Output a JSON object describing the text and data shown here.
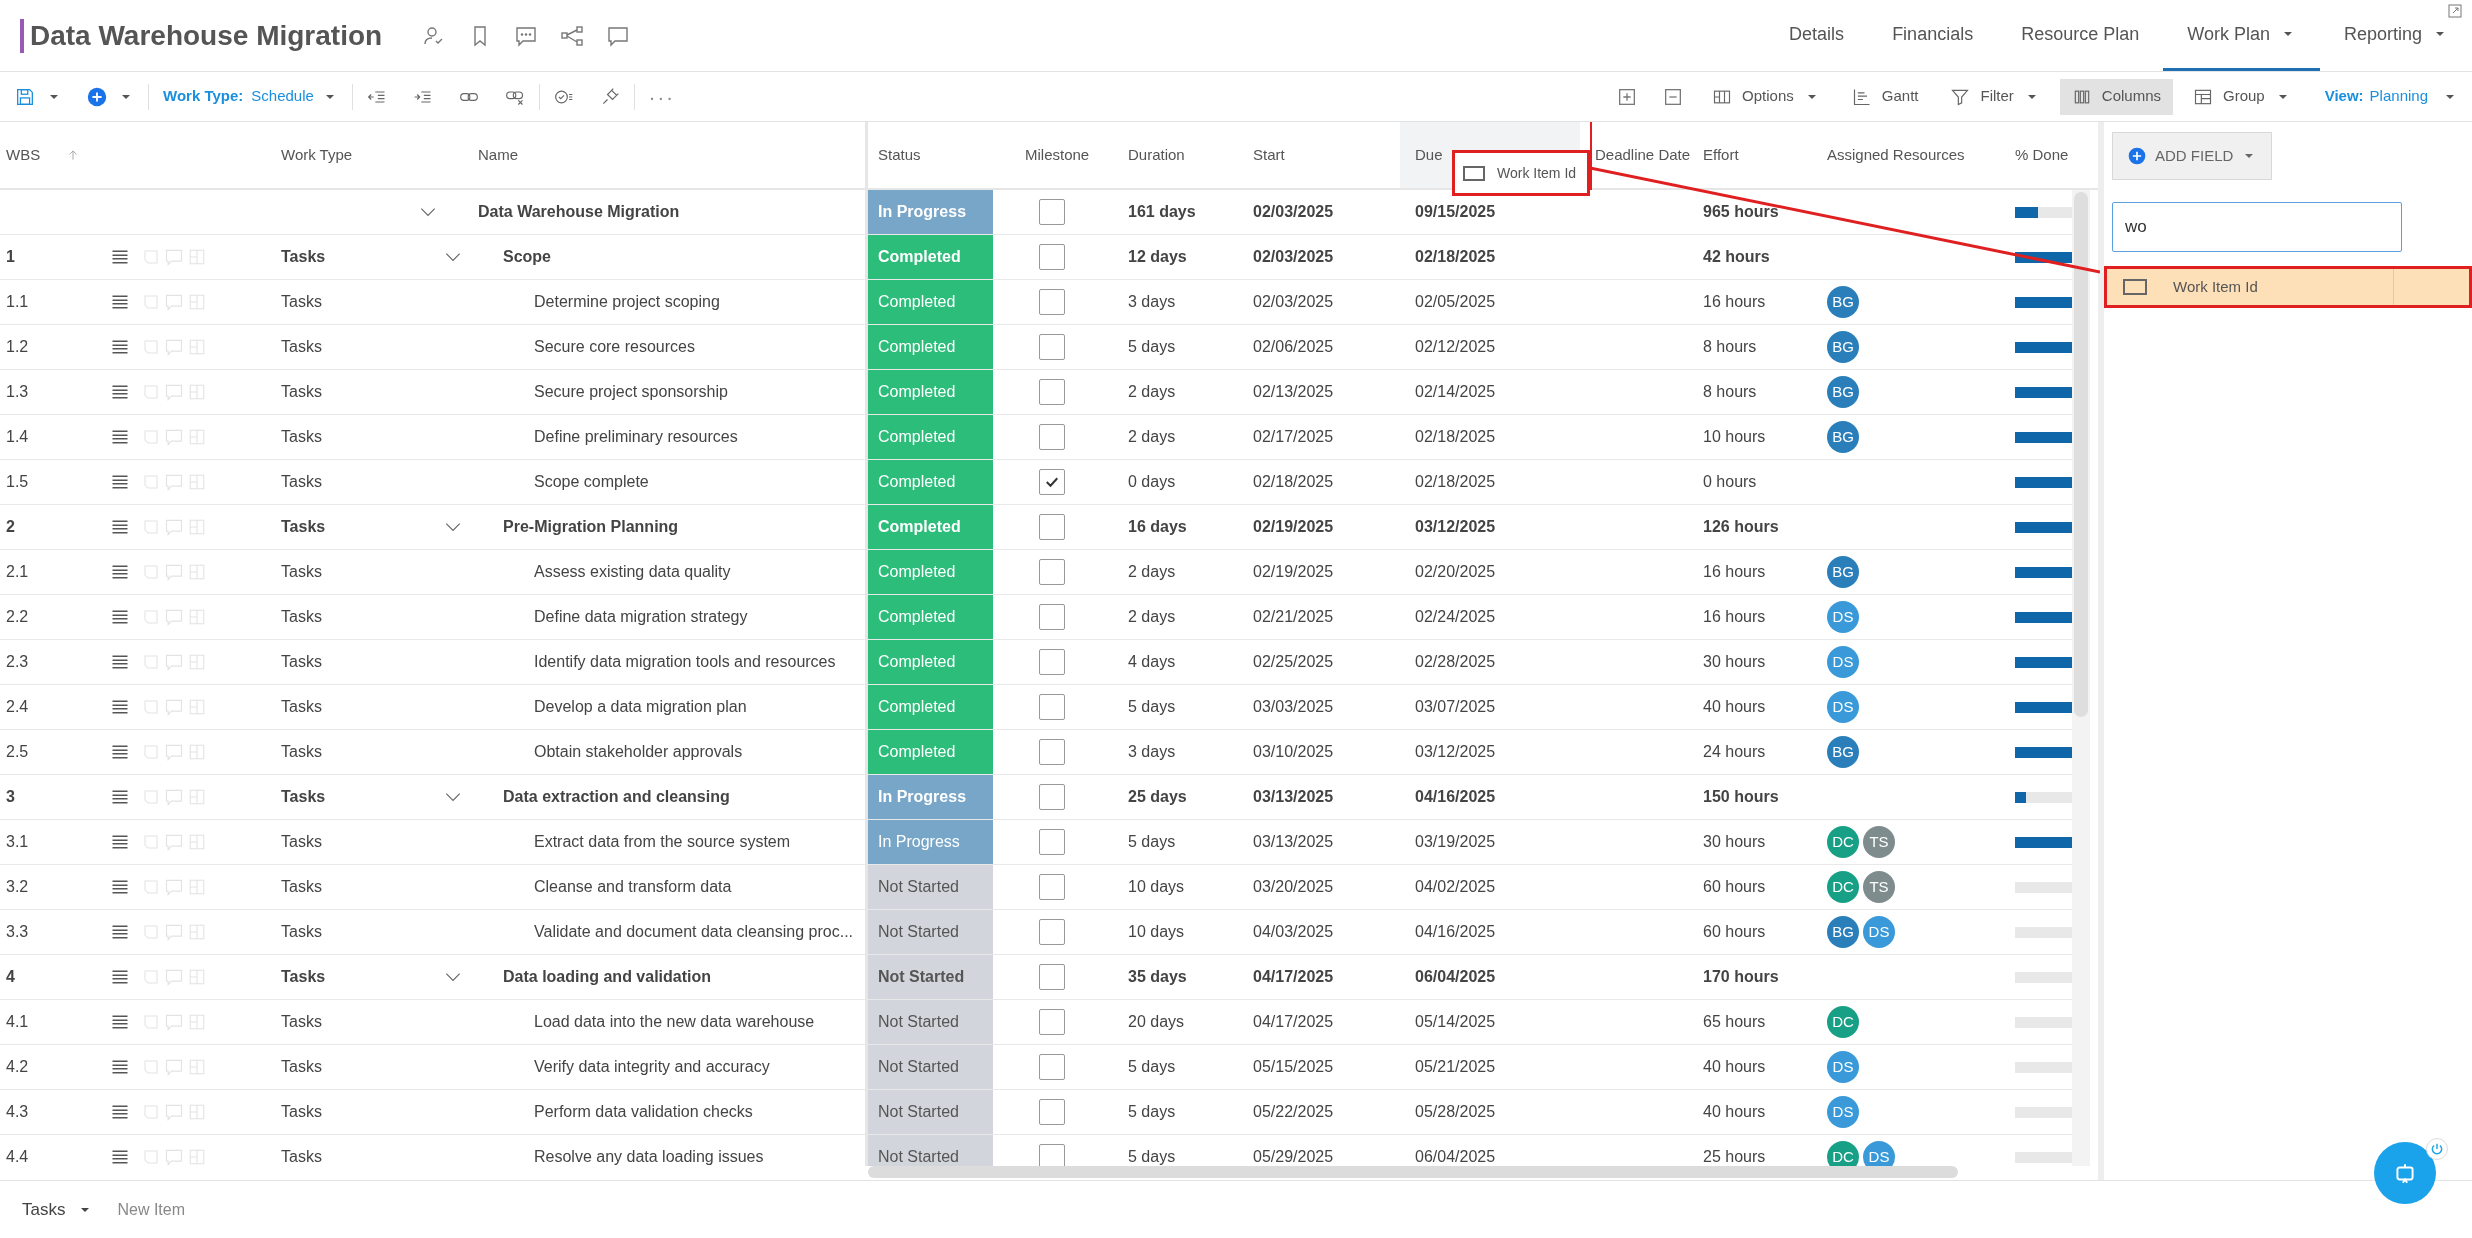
{
  "project": {
    "title": "Data Warehouse Migration"
  },
  "nav_tabs": [
    {
      "label": "Details",
      "selected": false,
      "dropdown": false
    },
    {
      "label": "Financials",
      "selected": false,
      "dropdown": false
    },
    {
      "label": "Resource Plan",
      "selected": false,
      "dropdown": false
    },
    {
      "label": "Work Plan",
      "selected": true,
      "dropdown": true
    },
    {
      "label": "Reporting",
      "selected": false,
      "dropdown": true
    }
  ],
  "toolbar": {
    "work_type": {
      "label": "Work Type:",
      "value": "Schedule"
    },
    "more": "···",
    "buttons": [
      {
        "kind": "options",
        "label": "Options",
        "dropdown": true,
        "selected": false
      },
      {
        "kind": "gantt",
        "label": "Gantt",
        "dropdown": false,
        "selected": false
      },
      {
        "kind": "filter",
        "label": "Filter",
        "dropdown": true,
        "selected": false
      },
      {
        "kind": "columns",
        "label": "Columns",
        "dropdown": false,
        "selected": true
      },
      {
        "kind": "group",
        "label": "Group",
        "dropdown": true,
        "selected": false
      }
    ],
    "view": {
      "label": "View:",
      "value": "Planning"
    }
  },
  "columns": [
    {
      "label": "WBS",
      "sorted_ascending": true,
      "drop_target": false
    },
    {
      "label": "Work Type",
      "sorted_ascending": false,
      "drop_target": false
    },
    {
      "label": "Name",
      "sorted_ascending": false,
      "drop_target": false
    },
    {
      "label": "Status",
      "sorted_ascending": false,
      "drop_target": false
    },
    {
      "label": "Milestone",
      "sorted_ascending": false,
      "drop_target": false
    },
    {
      "label": "Duration",
      "sorted_ascending": false,
      "drop_target": false
    },
    {
      "label": "Start",
      "sorted_ascending": false,
      "drop_target": false
    },
    {
      "label": "Due",
      "sorted_ascending": false,
      "drop_target": true
    },
    {
      "label": "Deadline Date",
      "sorted_ascending": false,
      "drop_target": false
    },
    {
      "label": "Effort",
      "sorted_ascending": false,
      "drop_target": false
    },
    {
      "label": "Assigned Resources",
      "sorted_ascending": false,
      "drop_target": false
    },
    {
      "label": "% Done",
      "sorted_ascending": false,
      "drop_target": false
    }
  ],
  "rows": [
    {
      "name": "Data Warehouse Migration",
      "status": "In Progress",
      "color": "#78a6c8",
      "milestone": false,
      "duration": "161 days",
      "start": "02/03/2025",
      "due": "09/15/2025",
      "effort": "965 hours",
      "level": 0.4,
      "expanded": true,
      "children": [
        {
          "wbs": "1",
          "work_type": "Tasks",
          "name": "Scope",
          "status": "Completed",
          "color": "#2dbd7b",
          "milestone": false,
          "duration": "12 days",
          "start": "02/03/2025",
          "due": "02/18/2025",
          "effort": "42 hours",
          "level": 1,
          "expanded": true,
          "children": [
            {
              "wbs": "1.1",
              "work_type": "Tasks",
              "name": "Determine project scoping",
              "status": "Completed",
              "color": "#2dbd7b",
              "milestone": false,
              "duration": "3 days",
              "start": "02/03/2025",
              "due": "02/05/2025",
              "effort": "16 hours",
              "level": 1,
              "resources": [
                {
                  "initials": "BG",
                  "color": "#2a7fba"
                }
              ]
            },
            {
              "wbs": "1.2",
              "work_type": "Tasks",
              "name": "Secure core resources",
              "status": "Completed",
              "color": "#2dbd7b",
              "milestone": false,
              "duration": "5 days",
              "start": "02/06/2025",
              "due": "02/12/2025",
              "effort": "8 hours",
              "level": 1,
              "resources": [
                {
                  "initials": "BG",
                  "color": "#2a7fba"
                }
              ]
            },
            {
              "wbs": "1.3",
              "work_type": "Tasks",
              "name": "Secure project sponsorship",
              "status": "Completed",
              "color": "#2dbd7b",
              "milestone": false,
              "duration": "2 days",
              "start": "02/13/2025",
              "due": "02/14/2025",
              "effort": "8 hours",
              "level": 1,
              "resources": [
                {
                  "initials": "BG",
                  "color": "#2a7fba"
                }
              ]
            },
            {
              "wbs": "1.4",
              "work_type": "Tasks",
              "name": "Define preliminary resources",
              "status": "Completed",
              "color": "#2dbd7b",
              "milestone": false,
              "duration": "2 days",
              "start": "02/17/2025",
              "due": "02/18/2025",
              "effort": "10 hours",
              "level": 1,
              "resources": [
                {
                  "initials": "BG",
                  "color": "#2a7fba"
                }
              ]
            },
            {
              "wbs": "1.5",
              "work_type": "Tasks",
              "name": "Scope complete",
              "status": "Completed",
              "color": "#2dbd7b",
              "milestone": true,
              "duration": "0 days",
              "start": "02/18/2025",
              "due": "02/18/2025",
              "effort": "0 hours",
              "level": 1
            }
          ]
        },
        {
          "wbs": "2",
          "work_type": "Tasks",
          "name": "Pre-Migration Planning",
          "status": "Completed",
          "color": "#2dbd7b",
          "milestone": false,
          "duration": "16 days",
          "start": "02/19/2025",
          "due": "03/12/2025",
          "effort": "126 hours",
          "level": 1,
          "expanded": true,
          "children": [
            {
              "wbs": "2.1",
              "work_type": "Tasks",
              "name": "Assess existing data quality",
              "status": "Completed",
              "color": "#2dbd7b",
              "milestone": false,
              "duration": "2 days",
              "start": "02/19/2025",
              "due": "02/20/2025",
              "effort": "16 hours",
              "level": 1,
              "resources": [
                {
                  "initials": "BG",
                  "color": "#2a7fba"
                }
              ]
            },
            {
              "wbs": "2.2",
              "work_type": "Tasks",
              "name": "Define data migration strategy",
              "status": "Completed",
              "color": "#2dbd7b",
              "milestone": false,
              "duration": "2 days",
              "start": "02/21/2025",
              "due": "02/24/2025",
              "effort": "16 hours",
              "level": 1,
              "resources": [
                {
                  "initials": "DS",
                  "color": "#3a9ad9"
                }
              ]
            },
            {
              "wbs": "2.3",
              "work_type": "Tasks",
              "name": "Identify data migration tools and resources",
              "status": "Completed",
              "color": "#2dbd7b",
              "milestone": false,
              "duration": "4 days",
              "start": "02/25/2025",
              "due": "02/28/2025",
              "effort": "30 hours",
              "level": 1,
              "resources": [
                {
                  "initials": "DS",
                  "color": "#3a9ad9"
                }
              ]
            },
            {
              "wbs": "2.4",
              "work_type": "Tasks",
              "name": "Develop a data migration plan",
              "status": "Completed",
              "color": "#2dbd7b",
              "milestone": false,
              "duration": "5 days",
              "start": "03/03/2025",
              "due": "03/07/2025",
              "effort": "40 hours",
              "level": 1,
              "resources": [
                {
                  "initials": "DS",
                  "color": "#3a9ad9"
                }
              ]
            },
            {
              "wbs": "2.5",
              "work_type": "Tasks",
              "name": "Obtain stakeholder approvals",
              "status": "Completed",
              "color": "#2dbd7b",
              "milestone": false,
              "duration": "3 days",
              "start": "03/10/2025",
              "due": "03/12/2025",
              "effort": "24 hours",
              "level": 1,
              "resources": [
                {
                  "initials": "BG",
                  "color": "#2a7fba"
                }
              ]
            }
          ]
        },
        {
          "wbs": "3",
          "work_type": "Tasks",
          "name": "Data extraction and cleansing",
          "status": "In Progress",
          "color": "#78a6c8",
          "milestone": false,
          "duration": "25 days",
          "start": "03/13/2025",
          "due": "04/16/2025",
          "effort": "150 hours",
          "level": 0.2,
          "expanded": true,
          "children": [
            {
              "wbs": "3.1",
              "work_type": "Tasks",
              "name": "Extract data from the source system",
              "status": "In Progress",
              "color": "#78a6c8",
              "milestone": false,
              "duration": "5 days",
              "start": "03/13/2025",
              "due": "03/19/2025",
              "effort": "30 hours",
              "level": 1,
              "resources": [
                {
                  "initials": "DC",
                  "color": "#17a085"
                },
                {
                  "initials": "TS",
                  "color": "#7f8c8d"
                }
              ]
            },
            {
              "wbs": "3.2",
              "work_type": "Tasks",
              "name": "Cleanse and transform data",
              "status": "Not Started",
              "color": "#d2d5db",
              "milestone": false,
              "duration": "10 days",
              "start": "03/20/2025",
              "due": "04/02/2025",
              "effort": "60 hours",
              "level": 0,
              "resources": [
                {
                  "initials": "DC",
                  "color": "#17a085"
                },
                {
                  "initials": "TS",
                  "color": "#7f8c8d"
                }
              ]
            },
            {
              "wbs": "3.3",
              "work_type": "Tasks",
              "name": "Validate and document data cleansing proc...",
              "status": "Not Started",
              "color": "#d2d5db",
              "milestone": false,
              "duration": "10 days",
              "start": "04/03/2025",
              "due": "04/16/2025",
              "effort": "60 hours",
              "level": 0,
              "resources": [
                {
                  "initials": "BG",
                  "color": "#2a7fba"
                },
                {
                  "initials": "DS",
                  "color": "#3a9ad9"
                }
              ]
            }
          ]
        },
        {
          "wbs": "4",
          "work_type": "Tasks",
          "name": "Data loading and validation",
          "status": "Not Started",
          "color": "#d2d5db",
          "milestone": false,
          "duration": "35 days",
          "start": "04/17/2025",
          "due": "06/04/2025",
          "effort": "170 hours",
          "level": 0,
          "expanded": true,
          "children": [
            {
              "wbs": "4.1",
              "work_type": "Tasks",
              "name": "Load data into the new data warehouse",
              "status": "Not Started",
              "color": "#d2d5db",
              "milestone": false,
              "duration": "20 days",
              "start": "04/17/2025",
              "due": "05/14/2025",
              "effort": "65 hours",
              "level": 0,
              "resources": [
                {
                  "initials": "DC",
                  "color": "#17a085"
                }
              ]
            },
            {
              "wbs": "4.2",
              "work_type": "Tasks",
              "name": "Verify data integrity and accuracy",
              "status": "Not Started",
              "color": "#d2d5db",
              "milestone": false,
              "duration": "5 days",
              "start": "05/15/2025",
              "due": "05/21/2025",
              "effort": "40 hours",
              "level": 0,
              "resources": [
                {
                  "initials": "DS",
                  "color": "#3a9ad9"
                }
              ]
            },
            {
              "wbs": "4.3",
              "work_type": "Tasks",
              "name": "Perform data validation checks",
              "status": "Not Started",
              "color": "#d2d5db",
              "milestone": false,
              "duration": "5 days",
              "start": "05/22/2025",
              "due": "05/28/2025",
              "effort": "40 hours",
              "level": 0,
              "resources": [
                {
                  "initials": "DS",
                  "color": "#3a9ad9"
                }
              ]
            },
            {
              "wbs": "4.4",
              "work_type": "Tasks",
              "name": "Resolve any data loading issues",
              "status": "Not Started",
              "color": "#d2d5db",
              "milestone": false,
              "duration": "5 days",
              "start": "05/29/2025",
              "due": "06/04/2025",
              "effort": "25 hours",
              "level": 0,
              "resources": [
                {
                  "initials": "DC",
                  "color": "#17a085"
                },
                {
                  "initials": "DS",
                  "color": "#3a9ad9"
                }
              ]
            }
          ]
        }
      ]
    }
  ],
  "drag_preview": {
    "label": "Work Item Id"
  },
  "field_panel": {
    "add_field": "ADD FIELD",
    "search_value": "wo",
    "fields": [
      {
        "label": "Work Item Id",
        "selected": true
      }
    ]
  },
  "footer": {
    "item_type": "Tasks",
    "new_item_placeholder": "New Item"
  }
}
